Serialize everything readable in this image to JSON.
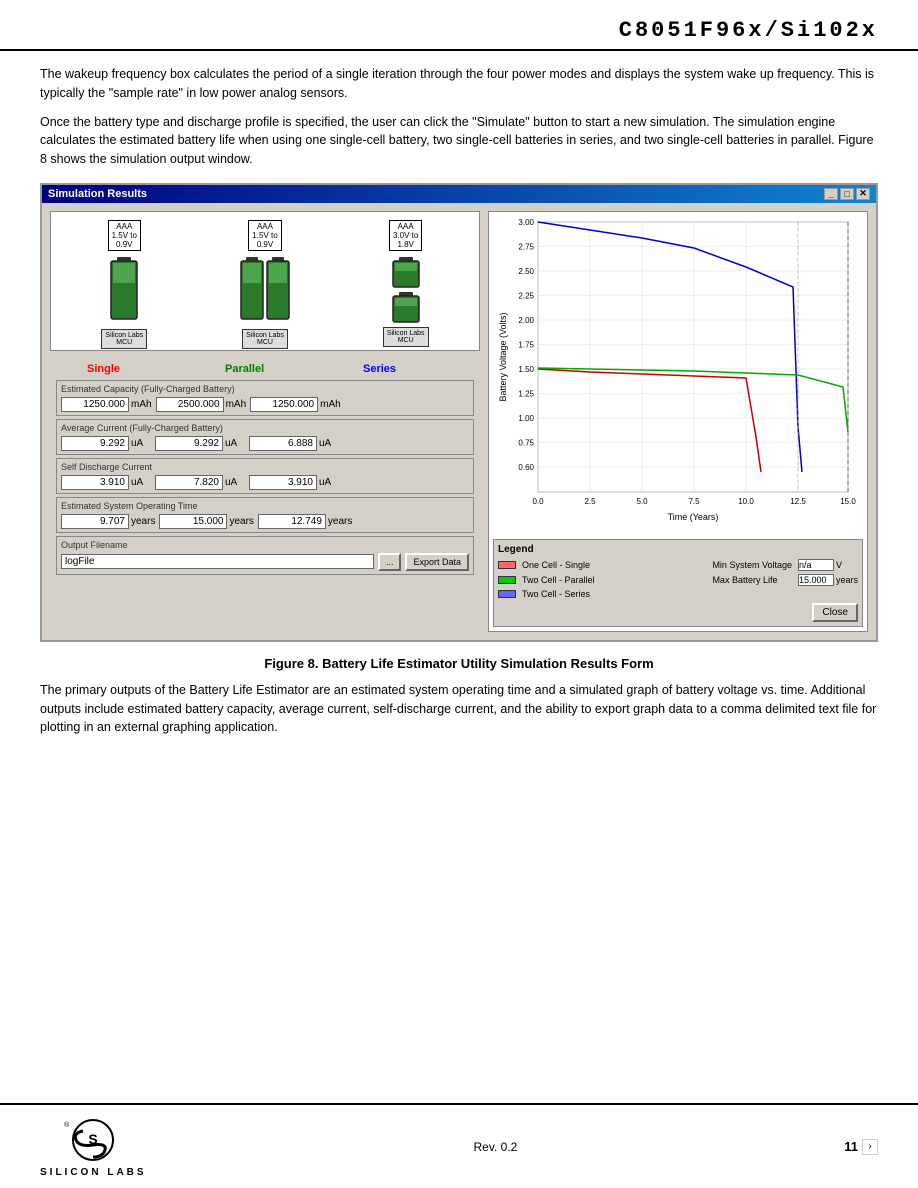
{
  "header": {
    "title": "C8051F96x/Si102x"
  },
  "paragraphs": [
    "The wakeup frequency box calculates the period of a single iteration through the four power modes and displays the system wake up frequency. This is typically the \"sample rate\" in low power analog sensors.",
    "Once the battery type and discharge profile is specified, the user can click the \"Simulate\" button to start a new simulation. The simulation engine calculates the estimated battery life when using one single-cell battery, two single-cell batteries in series, and two single-cell batteries in parallel. Figure 8 shows the simulation output window."
  ],
  "sim_window": {
    "title": "Simulation Results",
    "buttons": [
      "_",
      "□",
      "✕"
    ],
    "battery_configs": [
      {
        "label1": "AAA",
        "label2": "1.5V to",
        "label3": "0.9V",
        "mcu": "Silicon Labs MCU",
        "type": "single"
      },
      {
        "label1": "AAA",
        "label2": "1.5V to",
        "label3": "0.9V",
        "mcu": "Silicon Labs MCU",
        "type": "parallel"
      },
      {
        "label1": "AAA",
        "label2": "3.0V to",
        "label3": "1.8V",
        "mcu": "Silicon Labs MCU",
        "type": "series"
      }
    ],
    "col_labels": [
      "Single",
      "Parallel",
      "Series"
    ],
    "capacity_section": {
      "title": "Estimated Capacity (Fully-Charged Battery)",
      "values": [
        "1250.000",
        "2500.000",
        "1250.000"
      ],
      "unit": "mAh"
    },
    "avg_current_section": {
      "title": "Average Current (Fully-Charged Battery)",
      "values": [
        "9.292",
        "9.292",
        "6.888"
      ],
      "unit": "uA"
    },
    "self_discharge_section": {
      "title": "Self Discharge Current",
      "values": [
        "3.910",
        "7.820",
        "3.910"
      ],
      "unit": "uA"
    },
    "operating_time_section": {
      "title": "Estimated System Operating Time",
      "values": [
        "9.707",
        "15.000",
        "12.749"
      ],
      "unit": "years"
    },
    "output_filename": {
      "title": "Output Filename",
      "value": "logFile",
      "browse_label": "...",
      "export_label": "Export Data"
    },
    "legend": {
      "title": "Legend",
      "items": [
        {
          "color": "#ff6666",
          "label": "One Cell - Single"
        },
        {
          "color": "#ff0000",
          "label": "Min System Voltage"
        },
        {
          "color": "#00cc00",
          "label": "Two Cell - Parallel"
        },
        {
          "color": "#ffff00",
          "label": "Max Battery Life"
        },
        {
          "color": "#6666ff",
          "label": "Two Cell - Series"
        }
      ],
      "min_voltage_value": "n/a",
      "min_voltage_unit": "V",
      "max_life_value": "15.000",
      "max_life_unit": "years",
      "close_label": "Close"
    },
    "chart": {
      "y_label": "Battery Voltage (Volts)",
      "x_label": "Time (Years)",
      "y_ticks": [
        "3.00",
        "2.75",
        "2.50",
        "2.25",
        "2.00",
        "1.75",
        "1.50",
        "1.25",
        "1.00",
        "0.75",
        "0.60"
      ],
      "x_ticks": [
        "0.0",
        "2.5",
        "5.0",
        "7.5",
        "10.0",
        "12.5",
        "15.0"
      ]
    }
  },
  "figure_caption": "Figure 8.  Battery Life Estimator Utility Simulation Results Form",
  "body_paragraph": "The primary outputs of the Battery Life Estimator are an estimated system operating time and a simulated graph of battery voltage vs. time. Additional outputs include estimated battery capacity, average current, self-discharge current, and the ability to export graph data to a comma delimited text file for plotting in an external graphing application.",
  "footer": {
    "logo_text": "SILICON LABS",
    "rev": "Rev. 0.2",
    "page": "11"
  }
}
